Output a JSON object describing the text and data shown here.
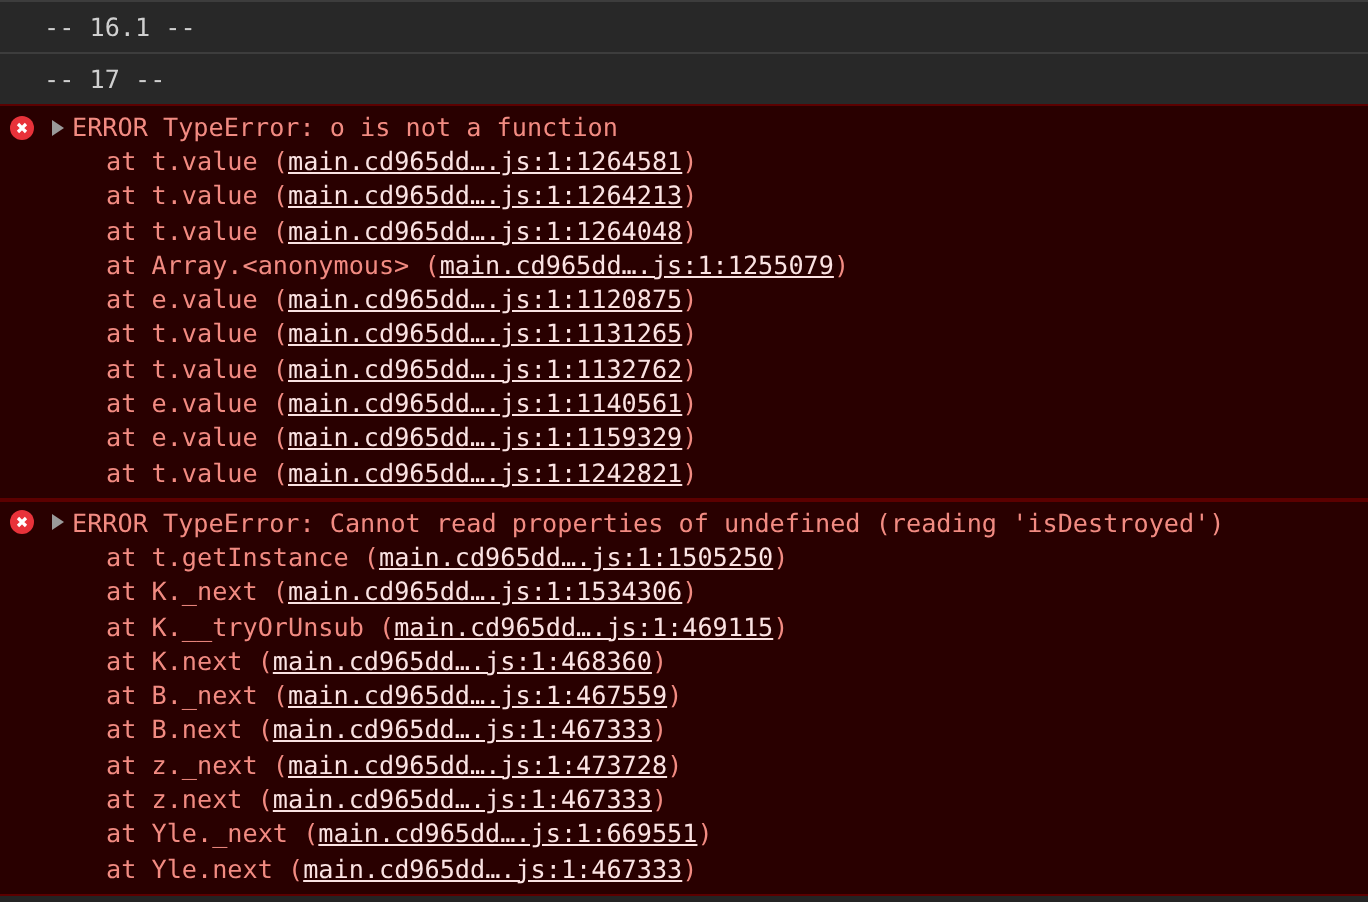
{
  "groups": [
    {
      "label": "-- 16.1 --"
    },
    {
      "label": "-- 17 --"
    }
  ],
  "errors": [
    {
      "expanded": false,
      "message": "ERROR TypeError: o is not a function",
      "frames": [
        {
          "prefix": "at t.value (",
          "link": "main.cd965dd….js:1:1264581",
          "suffix": ")"
        },
        {
          "prefix": "at t.value (",
          "link": "main.cd965dd….js:1:1264213",
          "suffix": ")"
        },
        {
          "prefix": "at t.value (",
          "link": "main.cd965dd….js:1:1264048",
          "suffix": ")"
        },
        {
          "prefix": "at Array.<anonymous> (",
          "link": "main.cd965dd….js:1:1255079",
          "suffix": ")"
        },
        {
          "prefix": "at e.value (",
          "link": "main.cd965dd….js:1:1120875",
          "suffix": ")"
        },
        {
          "prefix": "at t.value (",
          "link": "main.cd965dd….js:1:1131265",
          "suffix": ")"
        },
        {
          "prefix": "at t.value (",
          "link": "main.cd965dd….js:1:1132762",
          "suffix": ")"
        },
        {
          "prefix": "at e.value (",
          "link": "main.cd965dd….js:1:1140561",
          "suffix": ")"
        },
        {
          "prefix": "at e.value (",
          "link": "main.cd965dd….js:1:1159329",
          "suffix": ")"
        },
        {
          "prefix": "at t.value (",
          "link": "main.cd965dd….js:1:1242821",
          "suffix": ")"
        }
      ]
    },
    {
      "expanded": false,
      "message": "ERROR TypeError: Cannot read properties of undefined (reading 'isDestroyed')",
      "frames": [
        {
          "prefix": "at t.getInstance (",
          "link": "main.cd965dd….js:1:1505250",
          "suffix": ")"
        },
        {
          "prefix": "at K._next (",
          "link": "main.cd965dd….js:1:1534306",
          "suffix": ")"
        },
        {
          "prefix": "at K.__tryOrUnsub (",
          "link": "main.cd965dd….js:1:469115",
          "suffix": ")"
        },
        {
          "prefix": "at K.next (",
          "link": "main.cd965dd….js:1:468360",
          "suffix": ")"
        },
        {
          "prefix": "at B._next (",
          "link": "main.cd965dd….js:1:467559",
          "suffix": ")"
        },
        {
          "prefix": "at B.next (",
          "link": "main.cd965dd….js:1:467333",
          "suffix": ")"
        },
        {
          "prefix": "at z._next (",
          "link": "main.cd965dd….js:1:473728",
          "suffix": ")"
        },
        {
          "prefix": "at z.next (",
          "link": "main.cd965dd….js:1:467333",
          "suffix": ")"
        },
        {
          "prefix": "at Yle._next (",
          "link": "main.cd965dd….js:1:669551",
          "suffix": ")"
        },
        {
          "prefix": "at Yle.next (",
          "link": "main.cd965dd….js:1:467333",
          "suffix": ")"
        }
      ]
    }
  ]
}
